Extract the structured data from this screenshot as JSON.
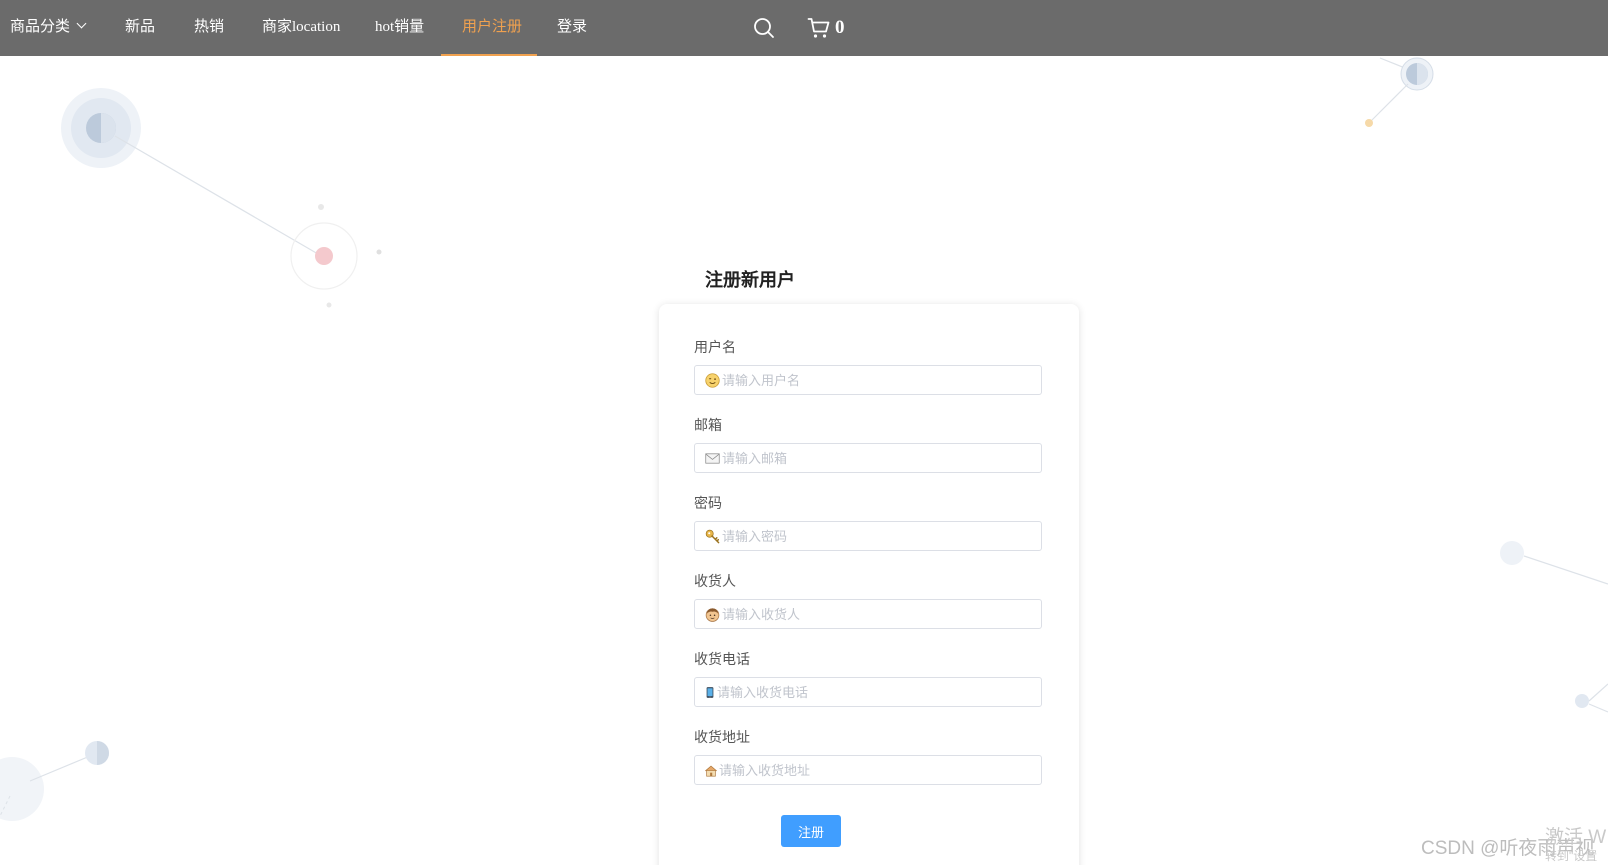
{
  "nav": {
    "items": [
      {
        "label": "商品分类",
        "has_dropdown": true
      },
      {
        "label": "新品"
      },
      {
        "label": "热销"
      },
      {
        "label": "商家location"
      },
      {
        "label": "hot销量"
      },
      {
        "label": "用户注册",
        "active": true
      },
      {
        "label": "登录"
      }
    ],
    "search_icon": "search-icon",
    "cart_icon": "shopping-cart-icon",
    "cart_count": "0",
    "active_color": "#f0a14f",
    "bg_color": "#6b6b6b"
  },
  "form": {
    "title": "注册新用户",
    "fields": [
      {
        "label": "用户名",
        "placeholder": "请输入用户名",
        "icon": "smiley-face-icon",
        "value": ""
      },
      {
        "label": "邮箱",
        "placeholder": "请输入邮箱",
        "icon": "envelope-icon",
        "value": ""
      },
      {
        "label": "密码",
        "placeholder": "请输入密码",
        "icon": "key-icon",
        "value": ""
      },
      {
        "label": "收货人",
        "placeholder": "请输入收货人",
        "icon": "person-face-icon",
        "value": ""
      },
      {
        "label": "收货电话",
        "placeholder": "请输入收货电话",
        "icon": "mobile-phone-icon",
        "value": ""
      },
      {
        "label": "收货地址",
        "placeholder": "请输入收货地址",
        "icon": "house-icon",
        "value": ""
      }
    ],
    "submit_label": "注册",
    "submit_color": "#409eff"
  },
  "watermark": "CSDN @听夜雨声视",
  "os_activate": {
    "title": "激活 W",
    "sub": "转到\"设置"
  }
}
